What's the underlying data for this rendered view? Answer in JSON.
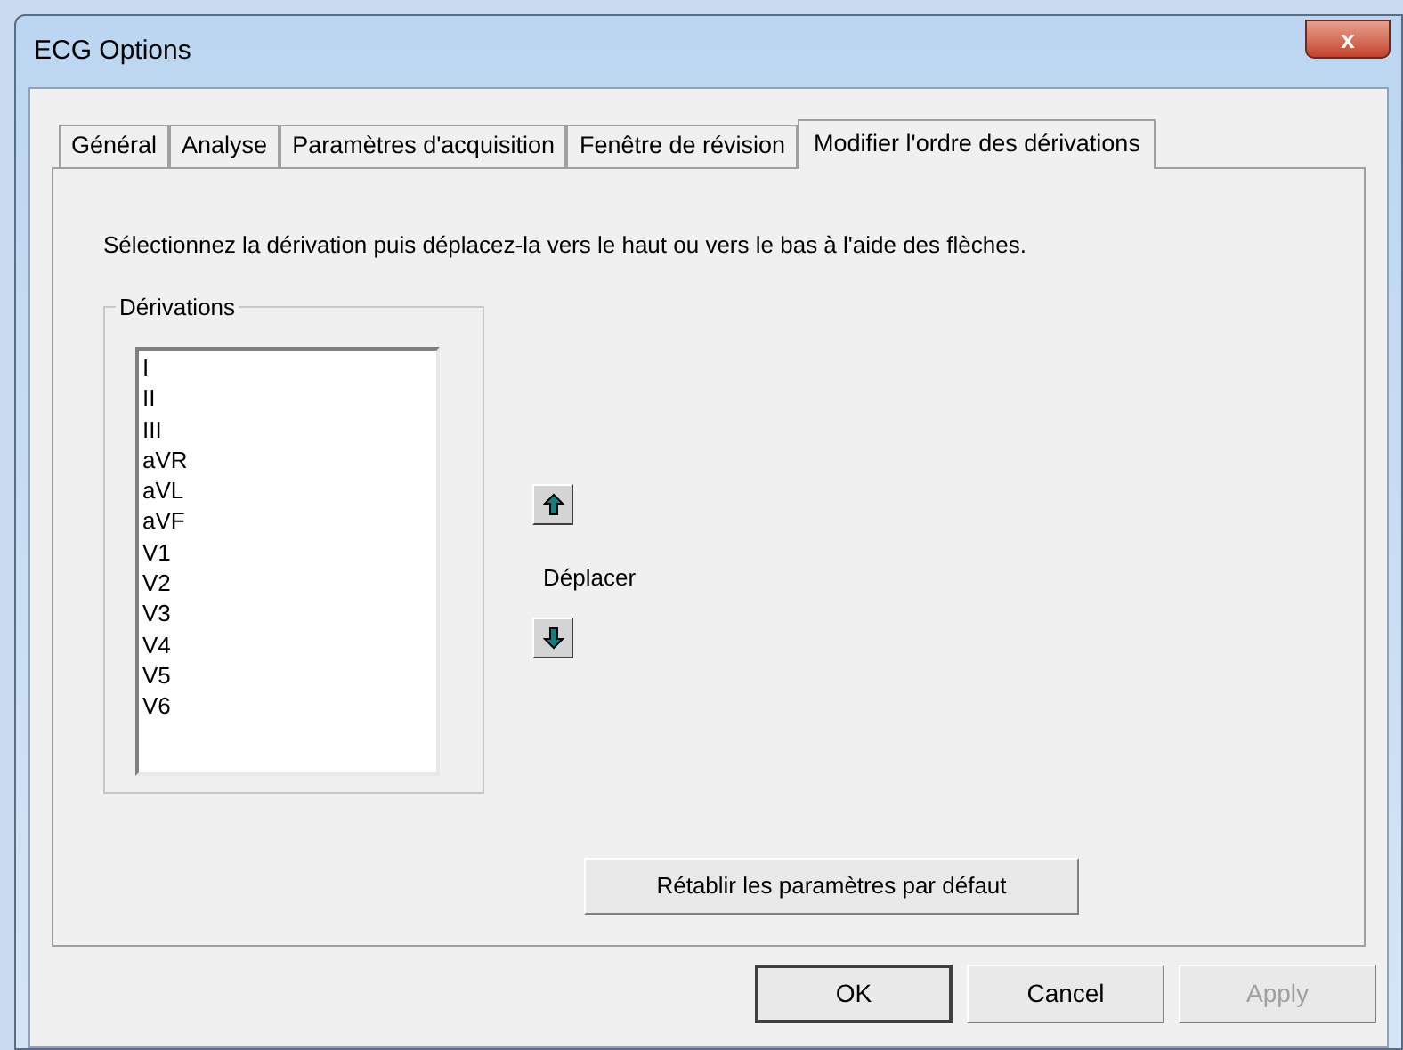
{
  "window": {
    "title": "ECG Options",
    "close_label": "x"
  },
  "tabs": [
    {
      "label": "Général",
      "selected": false
    },
    {
      "label": "Analyse",
      "selected": false
    },
    {
      "label": "Paramètres d'acquisition",
      "selected": false
    },
    {
      "label": "Fenêtre de révision",
      "selected": false
    },
    {
      "label": "Modifier l'ordre des dérivations",
      "selected": true
    }
  ],
  "instructions": "Sélectionnez la dérivation puis déplacez-la vers le haut ou vers le bas à l'aide des flèches.",
  "leads_group": {
    "title": "Dérivations",
    "items": [
      "I",
      "II",
      "III",
      "aVR",
      "aVL",
      "aVF",
      "V1",
      "V2",
      "V3",
      "V4",
      "V5",
      "V6"
    ]
  },
  "move_label": "Déplacer",
  "restore_button": "Rétablir les paramètres par défaut",
  "buttons": [
    {
      "label": "OK",
      "disabled": false,
      "default": true
    },
    {
      "label": "Cancel",
      "disabled": false,
      "default": false
    },
    {
      "label": "Apply",
      "disabled": true,
      "default": false
    }
  ]
}
